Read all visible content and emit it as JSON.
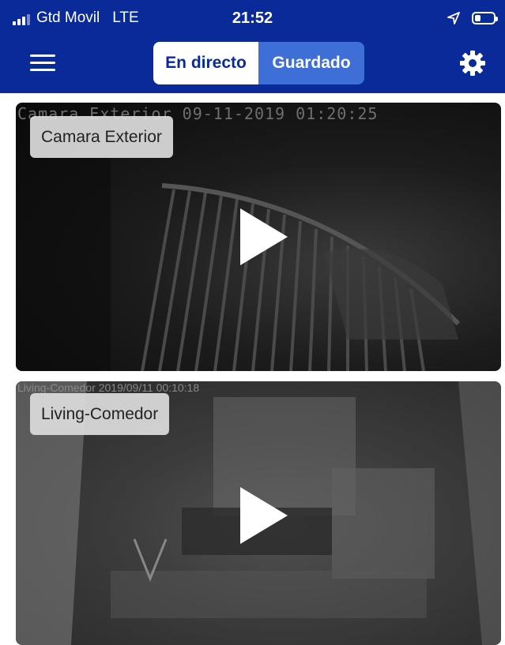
{
  "status_bar": {
    "carrier": "Gtd Movil",
    "network": "LTE",
    "time": "21:52",
    "battery_level": 0.3
  },
  "nav": {
    "tabs": [
      {
        "label": "En directo",
        "active": true
      },
      {
        "label": "Guardado",
        "active": false
      }
    ],
    "menu_icon": "hamburger-menu-icon",
    "settings_icon": "gear-icon"
  },
  "cameras": [
    {
      "name": "Camara Exterior",
      "overlay": "Camara Exterior  09-11-2019 01:20:25"
    },
    {
      "name": "Living-Comedor",
      "overlay": "Living-Comedor 2019/09/11 00:10:18"
    }
  ],
  "colors": {
    "header_bg": "#0a2a9a",
    "tab_inactive_bg": "#3d6fd6",
    "label_bg": "#dcdcdc"
  }
}
